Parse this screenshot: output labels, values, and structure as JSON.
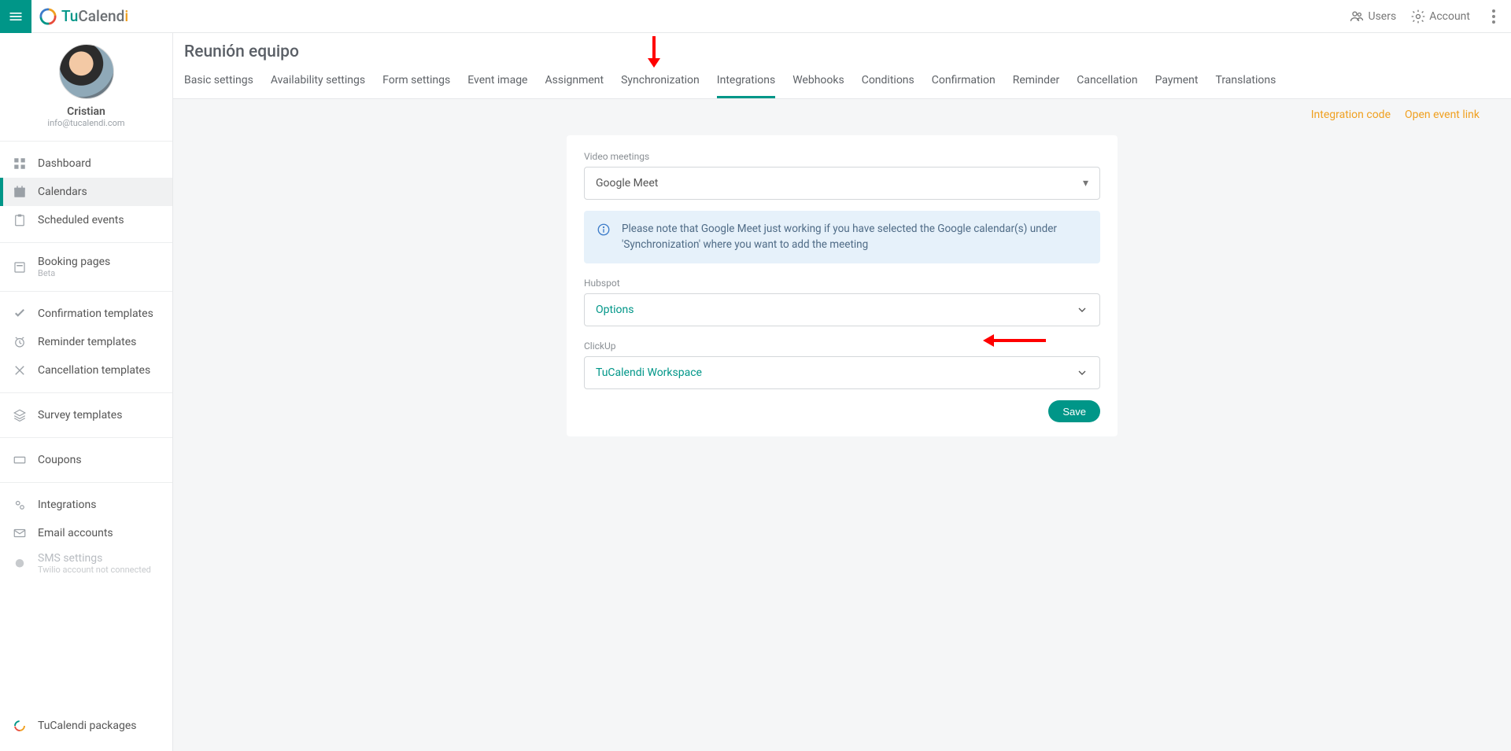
{
  "brand": {
    "part1": "Tu",
    "part2": "Calend",
    "part3": "i",
    "c1": "#009688",
    "c2": "#6b6f73",
    "c3": "#f0a020"
  },
  "header": {
    "users": "Users",
    "account": "Account"
  },
  "user": {
    "name": "Cristian",
    "email": "info@tucalendi.com"
  },
  "sidebar": {
    "items": [
      {
        "label": "Dashboard"
      },
      {
        "label": "Calendars"
      },
      {
        "label": "Scheduled events"
      },
      {
        "label": "Booking pages",
        "sub": "Beta"
      },
      {
        "label": "Confirmation templates"
      },
      {
        "label": "Reminder templates"
      },
      {
        "label": "Cancellation templates"
      },
      {
        "label": "Survey templates"
      },
      {
        "label": "Coupons"
      },
      {
        "label": "Integrations"
      },
      {
        "label": "Email accounts"
      },
      {
        "label": "SMS settings",
        "sub": "Twilio account not connected"
      },
      {
        "label": "TuCalendi packages"
      }
    ]
  },
  "page": {
    "title": "Reunión equipo",
    "tabs": [
      "Basic settings",
      "Availability settings",
      "Form settings",
      "Event image",
      "Assignment",
      "Synchronization",
      "Integrations",
      "Webhooks",
      "Conditions",
      "Confirmation",
      "Reminder",
      "Cancellation",
      "Payment",
      "Translations"
    ],
    "active_tab_index": 6,
    "sublinks": {
      "code": "Integration code",
      "open": "Open event link"
    }
  },
  "form": {
    "video_label": "Video meetings",
    "video_value": "Google Meet",
    "info": "Please note that Google Meet just working if you have selected the Google calendar(s) under 'Synchronization' where you want to add the meeting",
    "hubspot_label": "Hubspot",
    "hubspot_value": "Options",
    "clickup_label": "ClickUp",
    "clickup_value": "TuCalendi Workspace",
    "save": "Save"
  }
}
